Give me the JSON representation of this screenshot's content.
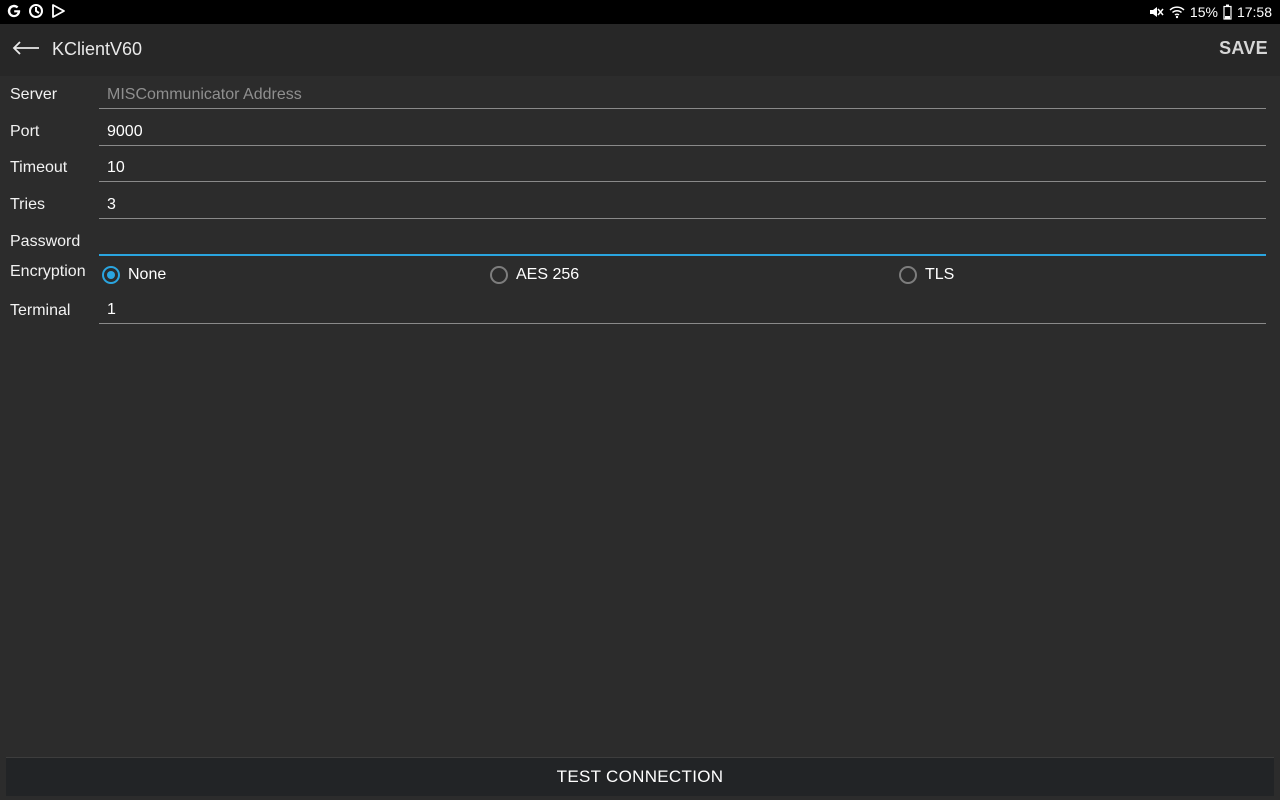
{
  "status_bar": {
    "left_icons": [
      "google-icon",
      "sync-icon",
      "play-store-icon"
    ],
    "right_icons": [
      "mute-icon",
      "wifi-icon",
      "battery-icon"
    ],
    "battery": "15%",
    "time": "17:58"
  },
  "app_bar": {
    "title": "KClientV60",
    "save_label": "SAVE",
    "back_icon": "back-arrow-icon"
  },
  "form": {
    "server": {
      "label": "Server",
      "value": "",
      "placeholder": "MISCommunicator Address"
    },
    "port": {
      "label": "Port",
      "value": "9000"
    },
    "timeout": {
      "label": "Timeout",
      "value": "10"
    },
    "tries": {
      "label": "Tries",
      "value": "3"
    },
    "password": {
      "label": "Password",
      "value": ""
    },
    "encryption": {
      "label": "Encryption",
      "options": [
        "None",
        "AES 256",
        "TLS"
      ],
      "selected": "None"
    },
    "terminal": {
      "label": "Terminal",
      "value": "1"
    }
  },
  "test_connection_label": "TEST CONNECTION",
  "colors": {
    "background": "#2c2c2c",
    "accent": "#2aa5e0",
    "app_bar": "#272727"
  }
}
